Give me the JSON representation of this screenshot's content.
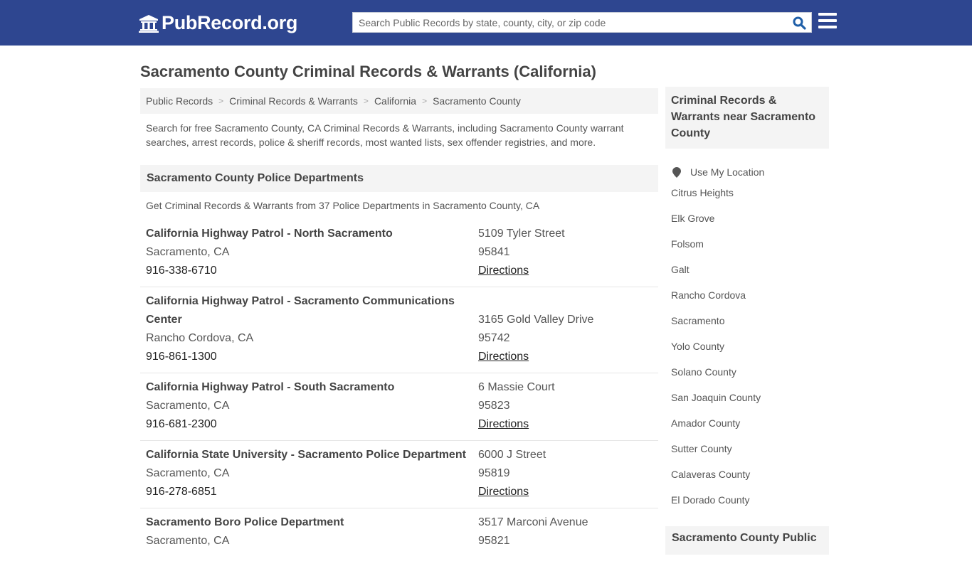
{
  "header": {
    "logo_text": "PubRecord.org",
    "search_placeholder": "Search Public Records by state, county, city, or zip code",
    "colors": {
      "bar": "#2e4690",
      "search_icon": "#1f5fa8"
    }
  },
  "page": {
    "title": "Sacramento County Criminal Records & Warrants (California)",
    "breadcrumb": [
      "Public Records",
      "Criminal Records & Warrants",
      "California",
      "Sacramento County"
    ],
    "intro": "Search for free Sacramento County, CA Criminal Records & Warrants, including Sacramento County warrant searches, arrest records, police & sheriff records, most wanted lists, sex offender registries, and more."
  },
  "section": {
    "title": "Sacramento County Police Departments",
    "subtitle": "Get Criminal Records & Warrants from 37 Police Departments in Sacramento County, CA"
  },
  "listings": [
    {
      "name": "California Highway Patrol - North Sacramento",
      "city": "Sacramento, CA",
      "phone": "916-338-6710",
      "address": "5109 Tyler Street",
      "zip": "95841",
      "directions": "Directions"
    },
    {
      "name": "California Highway Patrol - Sacramento Communications Center",
      "city": "Rancho Cordova, CA",
      "phone": "916-861-1300",
      "address": "3165 Gold Valley Drive",
      "zip": "95742",
      "directions": "Directions"
    },
    {
      "name": "California Highway Patrol - South Sacramento",
      "city": "Sacramento, CA",
      "phone": "916-681-2300",
      "address": "6 Massie Court",
      "zip": "95823",
      "directions": "Directions"
    },
    {
      "name": "California State University - Sacramento Police Department",
      "city": "Sacramento, CA",
      "phone": "916-278-6851",
      "address": "6000 J Street",
      "zip": "95819",
      "directions": "Directions"
    },
    {
      "name": "Sacramento Boro Police Department",
      "city": "Sacramento, CA",
      "phone": "",
      "address": "3517 Marconi Avenue",
      "zip": "95821",
      "directions": ""
    }
  ],
  "sidebar": {
    "title": "Criminal Records & Warrants near Sacramento County",
    "use_location": "Use My Location",
    "links": [
      "Citrus Heights",
      "Elk Grove",
      "Folsom",
      "Galt",
      "Rancho Cordova",
      "Sacramento",
      "Yolo County",
      "Solano County",
      "San Joaquin County",
      "Amador County",
      "Sutter County",
      "Calaveras County",
      "El Dorado County"
    ],
    "next_title": "Sacramento County Public"
  }
}
